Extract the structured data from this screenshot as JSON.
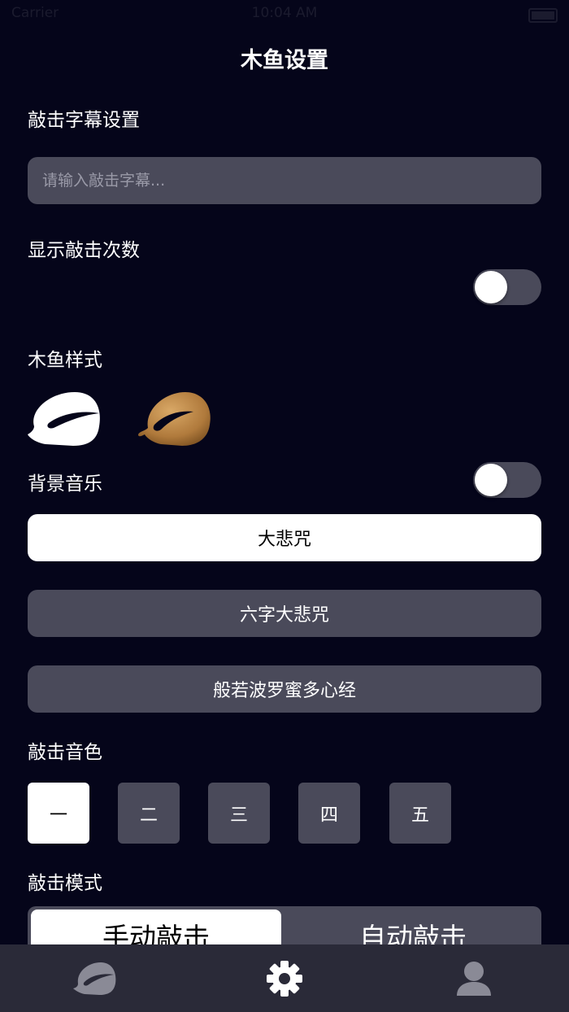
{
  "status_bar": {
    "carrier": "Carrier",
    "time": "10:04 AM"
  },
  "header": {
    "title": "木鱼设置"
  },
  "caption": {
    "label": "敲击字幕设置",
    "input_value": "",
    "input_placeholder": "请输入敲击字幕..."
  },
  "show_count": {
    "label": "显示敲击次数",
    "enabled": false
  },
  "fish_style": {
    "label": "木鱼样式",
    "options": [
      {
        "icon": "white-wooden-fish-icon",
        "color": "#ffffff"
      },
      {
        "icon": "brown-wooden-fish-icon",
        "color": "#b07a3c"
      }
    ]
  },
  "bg_music": {
    "label": "背景音乐",
    "enabled": false,
    "tracks": [
      {
        "label": "大悲咒",
        "selected": true
      },
      {
        "label": "六字大悲咒",
        "selected": false
      },
      {
        "label": "般若波罗蜜多心经",
        "selected": false
      }
    ]
  },
  "tone": {
    "label": "敲击音色",
    "options": [
      {
        "label": "一",
        "selected": true
      },
      {
        "label": "二",
        "selected": false
      },
      {
        "label": "三",
        "selected": false
      },
      {
        "label": "四",
        "selected": false
      },
      {
        "label": "五",
        "selected": false
      }
    ]
  },
  "mode": {
    "label": "敲击模式",
    "options": [
      {
        "label": "手动敲击",
        "selected": true
      },
      {
        "label": "自动敲击",
        "selected": false
      }
    ]
  },
  "tab_bar": {
    "items": [
      {
        "icon": "wooden-fish-icon",
        "active": false
      },
      {
        "icon": "gear-icon",
        "active": true
      },
      {
        "icon": "user-icon",
        "active": false
      }
    ]
  },
  "colors": {
    "background": "#05051a",
    "control": "#4a4a5a",
    "selected": "#ffffff",
    "tab_bar": "#2a2a38"
  }
}
